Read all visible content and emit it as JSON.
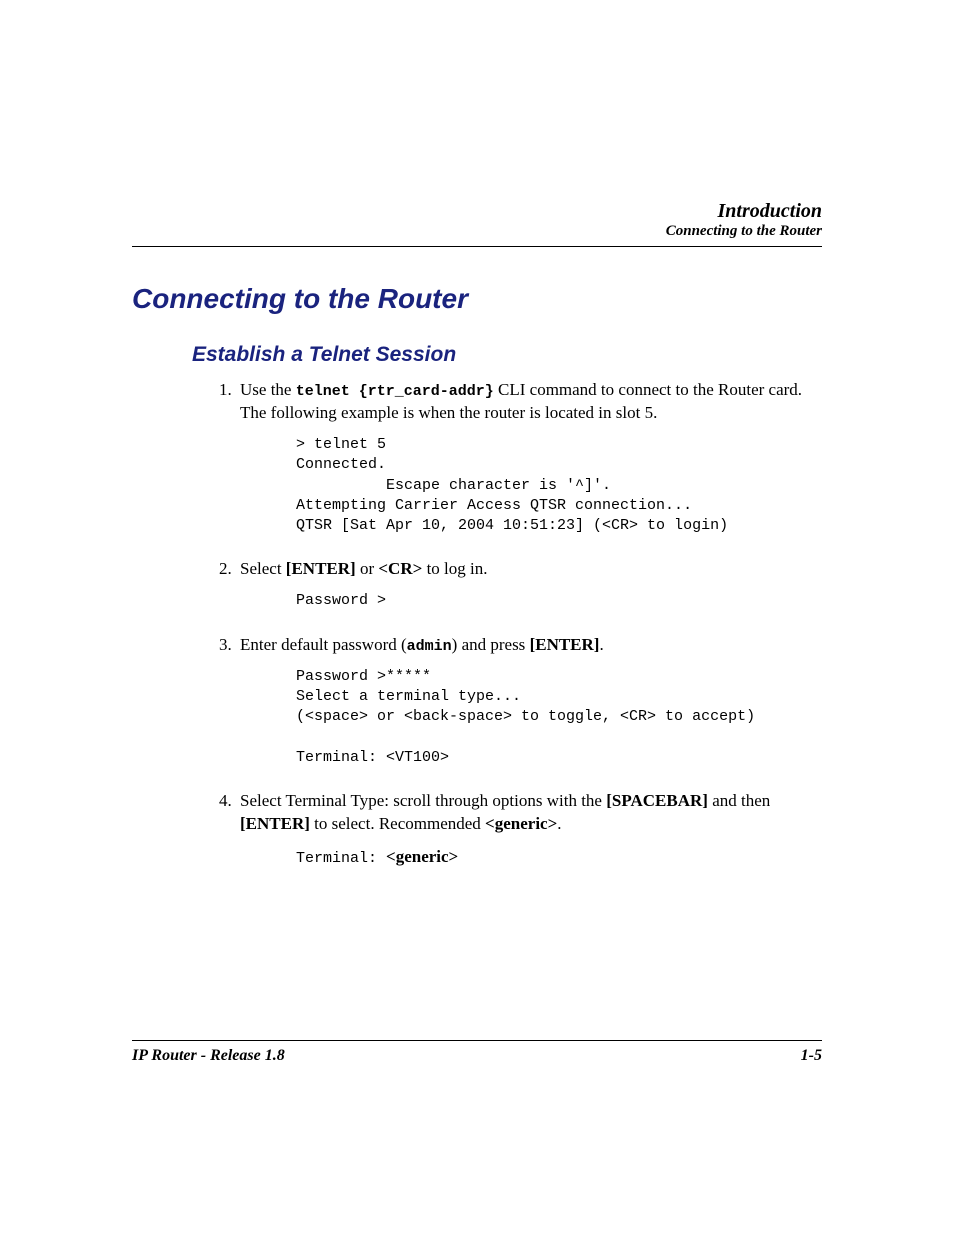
{
  "header": {
    "chapter": "Introduction",
    "section": "Connecting to the Router"
  },
  "title": "Connecting to the Router",
  "subtitle": "Establish a Telnet Session",
  "steps": {
    "s1": {
      "text_a": "Use the ",
      "cmd": "telnet {rtr_card-addr}",
      "text_b": " CLI command to connect to the Router card. The following example is when the router is located in slot 5.",
      "terminal": "> telnet 5\nConnected.\n          Escape character is '^]'.\nAttempting Carrier Access QTSR connection...\nQTSR [Sat Apr 10, 2004 10:51:23] (<CR> to login)"
    },
    "s2": {
      "text_a": "Select ",
      "key1_open": "[E",
      "key1_rest": "NTER",
      "key1_close": "]",
      "text_b": " or ",
      "cr": "<CR>",
      "text_c": " to log in.",
      "terminal": "Password >"
    },
    "s3": {
      "text_a": "Enter default password (",
      "pw": "admin",
      "text_b": ") and press ",
      "key1_open": "[E",
      "key1_rest": "NTER",
      "key1_close": "]",
      "text_c": ".",
      "terminal": "Password >*****\nSelect a terminal type...\n(<space> or <back-space> to toggle, <CR> to accept)\n\nTerminal: <VT100>"
    },
    "s4": {
      "text_a": "Select Terminal Type: scroll through options with the ",
      "key1_open": "[S",
      "key1_rest": "PACEBAR",
      "key1_close": "]",
      "text_b": " and then ",
      "key2_open": "[E",
      "key2_rest": "NTER",
      "key2_close": "]",
      "text_c": " to select. Recommended ",
      "rec": "<generic>",
      "text_d": ".",
      "terminal_a": "Terminal: ",
      "terminal_b": "<generic>"
    }
  },
  "footer": {
    "left": "IP Router - Release 1.8",
    "right": "1-5"
  }
}
